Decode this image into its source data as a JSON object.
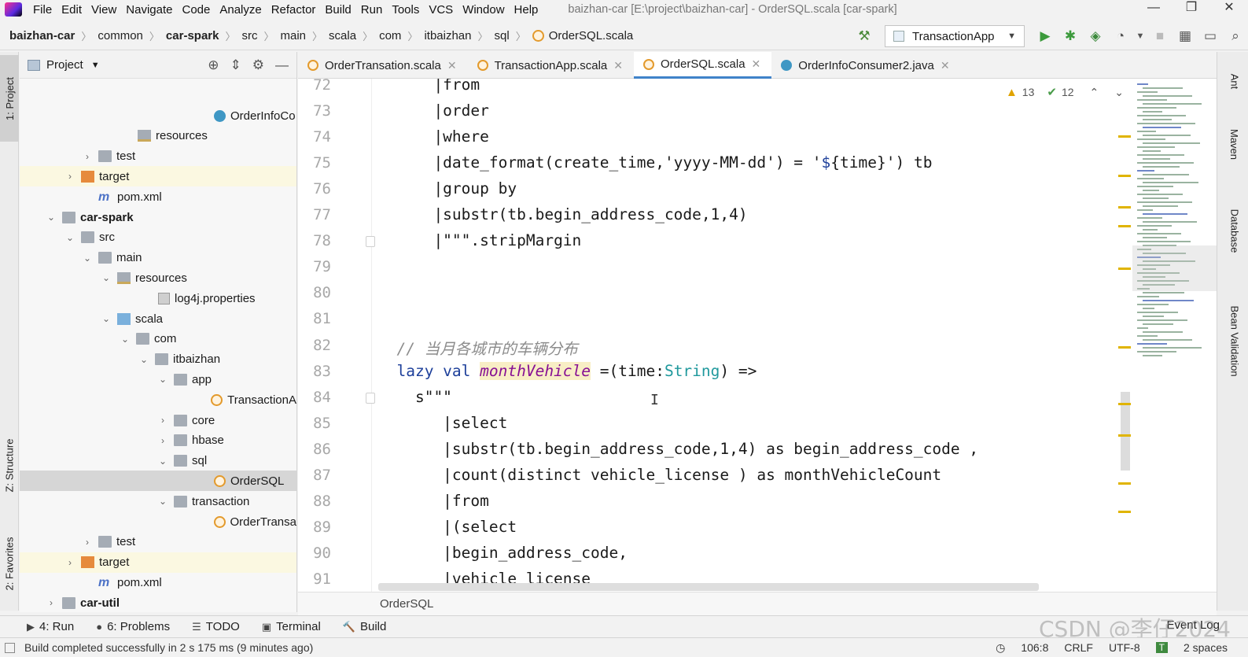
{
  "menubar": {
    "items": [
      "File",
      "Edit",
      "View",
      "Navigate",
      "Code",
      "Analyze",
      "Refactor",
      "Build",
      "Run",
      "Tools",
      "VCS",
      "Window",
      "Help"
    ],
    "title": "baizhan-car [E:\\project\\baizhan-car] - OrderSQL.scala [car-spark]",
    "minimize": "—",
    "restore": "❐",
    "close": "✕"
  },
  "breadcrumb": [
    "baizhan-car",
    "common",
    "car-spark",
    "src",
    "main",
    "scala",
    "com",
    "itbaizhan",
    "sql",
    "OrderSQL.scala"
  ],
  "run_config": "TransactionApp",
  "left_strip": {
    "project": "1: Project",
    "structure": "Z: Structure",
    "favorites": "2: Favorites"
  },
  "project_panel": {
    "title": "Project"
  },
  "tree": [
    {
      "label": "OrderInfoCo",
      "icon": "java",
      "indent": 247,
      "arrow": ""
    },
    {
      "label": "resources",
      "icon": "res",
      "indent": 150,
      "arrow": ""
    },
    {
      "label": "test",
      "icon": "folder",
      "indent": 100,
      "arrow": "›"
    },
    {
      "label": "target",
      "icon": "folder-orange",
      "indent": 78,
      "arrow": "›",
      "hl": true
    },
    {
      "label": "pom.xml",
      "icon": "maven",
      "indent": 100,
      "arrow": ""
    },
    {
      "label": "car-spark",
      "icon": "folder",
      "indent": 54,
      "arrow": "⌄",
      "bold": true
    },
    {
      "label": "src",
      "icon": "folder",
      "indent": 78,
      "arrow": "⌄"
    },
    {
      "label": "main",
      "icon": "folder",
      "indent": 100,
      "arrow": "⌄"
    },
    {
      "label": "resources",
      "icon": "res",
      "indent": 124,
      "arrow": "⌄"
    },
    {
      "label": "log4j.properties",
      "icon": "props",
      "indent": 176,
      "arrow": ""
    },
    {
      "label": "scala",
      "icon": "folder-blue",
      "indent": 124,
      "arrow": "⌄"
    },
    {
      "label": "com",
      "icon": "folder",
      "indent": 148,
      "arrow": "⌄"
    },
    {
      "label": "itbaizhan",
      "icon": "folder",
      "indent": 172,
      "arrow": "⌄"
    },
    {
      "label": "app",
      "icon": "folder",
      "indent": 196,
      "arrow": "⌄"
    },
    {
      "label": "TransactionA",
      "icon": "scala",
      "indent": 247,
      "arrow": ""
    },
    {
      "label": "core",
      "icon": "folder",
      "indent": 196,
      "arrow": "›"
    },
    {
      "label": "hbase",
      "icon": "folder",
      "indent": 196,
      "arrow": "›"
    },
    {
      "label": "sql",
      "icon": "folder",
      "indent": 196,
      "arrow": "⌄"
    },
    {
      "label": "OrderSQL",
      "icon": "scala",
      "indent": 247,
      "arrow": "",
      "sel": true
    },
    {
      "label": "transaction",
      "icon": "folder",
      "indent": 196,
      "arrow": "⌄"
    },
    {
      "label": "OrderTransa",
      "icon": "scala",
      "indent": 247,
      "arrow": ""
    },
    {
      "label": "test",
      "icon": "folder",
      "indent": 100,
      "arrow": "›"
    },
    {
      "label": "target",
      "icon": "folder-orange",
      "indent": 78,
      "arrow": "›",
      "hl": true
    },
    {
      "label": "pom.xml",
      "icon": "maven",
      "indent": 100,
      "arrow": ""
    },
    {
      "label": "car-util",
      "icon": "folder",
      "indent": 54,
      "arrow": "›",
      "bold": true
    },
    {
      "label": "portal",
      "icon": "folder",
      "indent": 54,
      "arrow": ""
    }
  ],
  "watermark": "itbaizhan",
  "tabs": [
    {
      "label": "OrderTransation.scala",
      "icon": "scala"
    },
    {
      "label": "TransactionApp.scala",
      "icon": "scala"
    },
    {
      "label": "OrderSQL.scala",
      "icon": "scala",
      "active": true
    },
    {
      "label": "OrderInfoConsumer2.java",
      "icon": "java"
    }
  ],
  "inspections": {
    "warnings": "13",
    "weak": "12"
  },
  "line_numbers": [
    "72",
    "73",
    "74",
    "75",
    "76",
    "77",
    "78",
    "79",
    "80",
    "81",
    "82",
    "83",
    "84",
    "85",
    "86",
    "87",
    "88",
    "89",
    "90",
    "91"
  ],
  "code": [
    {
      "indent": 0,
      "segments": [
        {
          "t": "      |from",
          "c": "str-plain"
        }
      ]
    },
    {
      "indent": 0,
      "segments": [
        {
          "t": "      |order",
          "c": ""
        }
      ]
    },
    {
      "indent": 0,
      "segments": [
        {
          "t": "      |where",
          "c": ""
        }
      ]
    },
    {
      "indent": 0,
      "segments": [
        {
          "t": "      |date_format(create_time,'yyyy-MM-dd') = '",
          "c": ""
        },
        {
          "t": "$",
          "c": "kw"
        },
        {
          "t": "{time}",
          "c": ""
        },
        {
          "t": "') tb",
          "c": ""
        }
      ]
    },
    {
      "indent": 0,
      "segments": [
        {
          "t": "      |group by",
          "c": ""
        }
      ]
    },
    {
      "indent": 0,
      "segments": [
        {
          "t": "      |substr(tb.begin_address_code,1,4)",
          "c": ""
        }
      ]
    },
    {
      "indent": 0,
      "segments": [
        {
          "t": "      |\"\"\"",
          "c": ""
        },
        {
          "t": ".stripMargin",
          "c": ""
        }
      ]
    },
    {
      "indent": 0,
      "segments": []
    },
    {
      "indent": 0,
      "segments": []
    },
    {
      "indent": 0,
      "segments": []
    },
    {
      "indent": 0,
      "segments": [
        {
          "t": "  // 当月各城市的车辆分布",
          "c": "cmt"
        }
      ]
    },
    {
      "indent": 0,
      "segments": [
        {
          "t": "  lazy val ",
          "c": "kw"
        },
        {
          "t": "monthVehicle",
          "c": "fld"
        },
        {
          "t": " =(time:",
          "c": ""
        },
        {
          "t": "String",
          "c": "type"
        },
        {
          "t": ") =>",
          "c": ""
        }
      ]
    },
    {
      "indent": 0,
      "segments": [
        {
          "t": "    s\"\"\"",
          "c": ""
        }
      ]
    },
    {
      "indent": 0,
      "segments": [
        {
          "t": "       |select",
          "c": ""
        }
      ]
    },
    {
      "indent": 0,
      "segments": [
        {
          "t": "       |substr(tb.begin_address_code,1,4) as begin_address_code ,",
          "c": ""
        }
      ]
    },
    {
      "indent": 0,
      "segments": [
        {
          "t": "       |count(distinct vehicle_license ) as monthVehicleCount",
          "c": ""
        }
      ]
    },
    {
      "indent": 0,
      "segments": [
        {
          "t": "       |from",
          "c": ""
        }
      ]
    },
    {
      "indent": 0,
      "segments": [
        {
          "t": "       |(select",
          "c": ""
        }
      ]
    },
    {
      "indent": 0,
      "segments": [
        {
          "t": "       |begin_address_code,",
          "c": ""
        }
      ]
    },
    {
      "indent": 0,
      "segments": [
        {
          "t": "       |vehicle_license",
          "c": ""
        }
      ]
    }
  ],
  "editor_crumb": "OrderSQL",
  "right_strip": {
    "ant": "Ant",
    "maven": "Maven",
    "database": "Database",
    "bean": "Bean Validation"
  },
  "bottom_tabs": [
    {
      "label": "4: Run",
      "icon": "▶"
    },
    {
      "label": "6: Problems",
      "icon": "●"
    },
    {
      "label": "TODO",
      "icon": "☰"
    },
    {
      "label": "Terminal",
      "icon": "▣"
    },
    {
      "label": "Build",
      "icon": "🔨"
    }
  ],
  "event_log": "Event Log",
  "csdn": "CSDN @李仔2024",
  "status": {
    "message": "Build completed successfully in 2 s 175 ms (9 minutes ago)",
    "position": "106:8",
    "line_sep": "CRLF",
    "encoding": "UTF-8",
    "indent": "2 spaces"
  }
}
